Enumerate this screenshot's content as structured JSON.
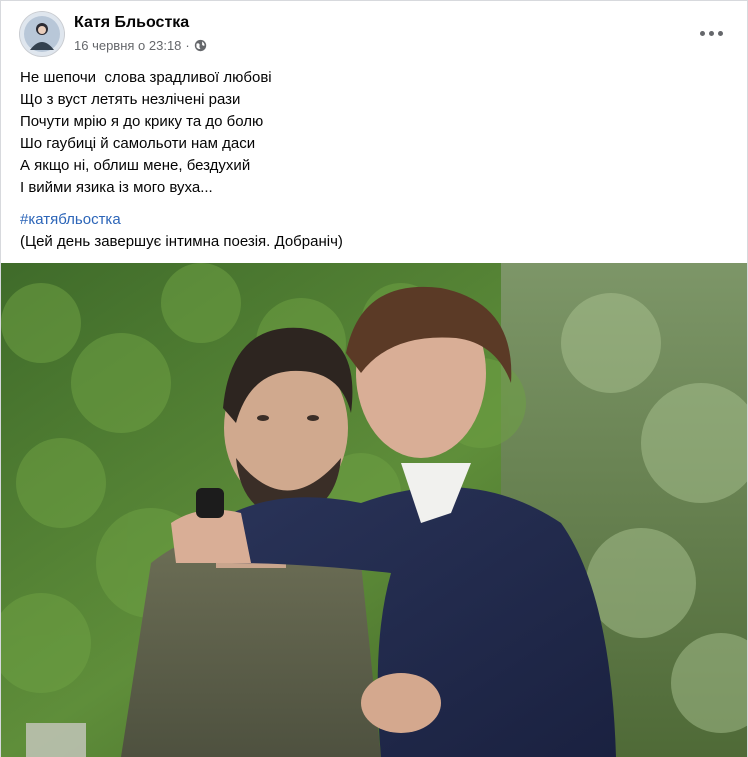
{
  "post": {
    "author": "Катя Бльостка",
    "timestamp": "16 червня о 23:18",
    "separator": "·",
    "privacy_icon": "globe-icon",
    "more_icon": "more-options-icon",
    "text_lines": [
      "Не шепочи  слова зрадливої любові",
      "Що з вуст летять незлічені рази",
      "Почути мрію я до крику та до болю",
      "Шо гаубиці й самольоти нам даси",
      "А якщо ні, облиш мене, бездухий",
      "І вийми язика із мого вуха..."
    ],
    "hashtag": "#катябльостка",
    "footer": "(Цей день завершує інтимна поезія. Добраніч)",
    "photo_description": "post-photo"
  },
  "colors": {
    "link": "#2c65b8",
    "secondary_text": "#65676b",
    "primary_text": "#050505"
  }
}
